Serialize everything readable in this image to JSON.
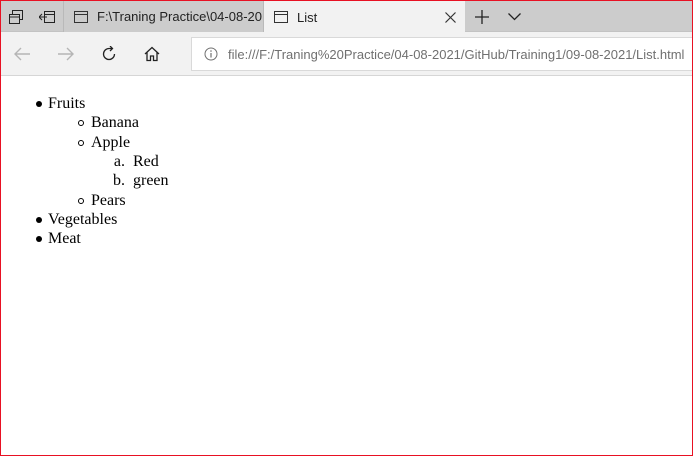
{
  "browser": {
    "tabs": [
      {
        "title": "F:\\Traning Practice\\04-08-20",
        "active": false
      },
      {
        "title": "List",
        "active": true
      }
    ],
    "address": {
      "url": "file:///F:/Traning%20Practice/04-08-2021/GitHub/Training1/09-08-2021/List.html"
    },
    "icons": {
      "tab_manager": "tab-manager-icon",
      "set_aside": "set-tabs-aside-icon",
      "close": "close-icon",
      "new_tab": "plus-icon",
      "tab_list": "chevron-down-icon",
      "back": "back-arrow-icon",
      "forward": "forward-arrow-icon",
      "refresh": "refresh-icon",
      "home": "home-icon",
      "info": "info-icon"
    },
    "colors": {
      "window_border": "#e81123",
      "tabstrip": "#cccccc",
      "active_tab": "#f2f2f2"
    }
  },
  "page": {
    "items": [
      {
        "label": "Fruits",
        "children": [
          {
            "label": "Banana"
          },
          {
            "label": "Apple",
            "children": [
              {
                "marker": "a.",
                "label": "Red"
              },
              {
                "marker": "b.",
                "label": "green"
              }
            ]
          },
          {
            "label": "Pears"
          }
        ]
      },
      {
        "label": "Vegetables"
      },
      {
        "label": "Meat"
      }
    ]
  }
}
